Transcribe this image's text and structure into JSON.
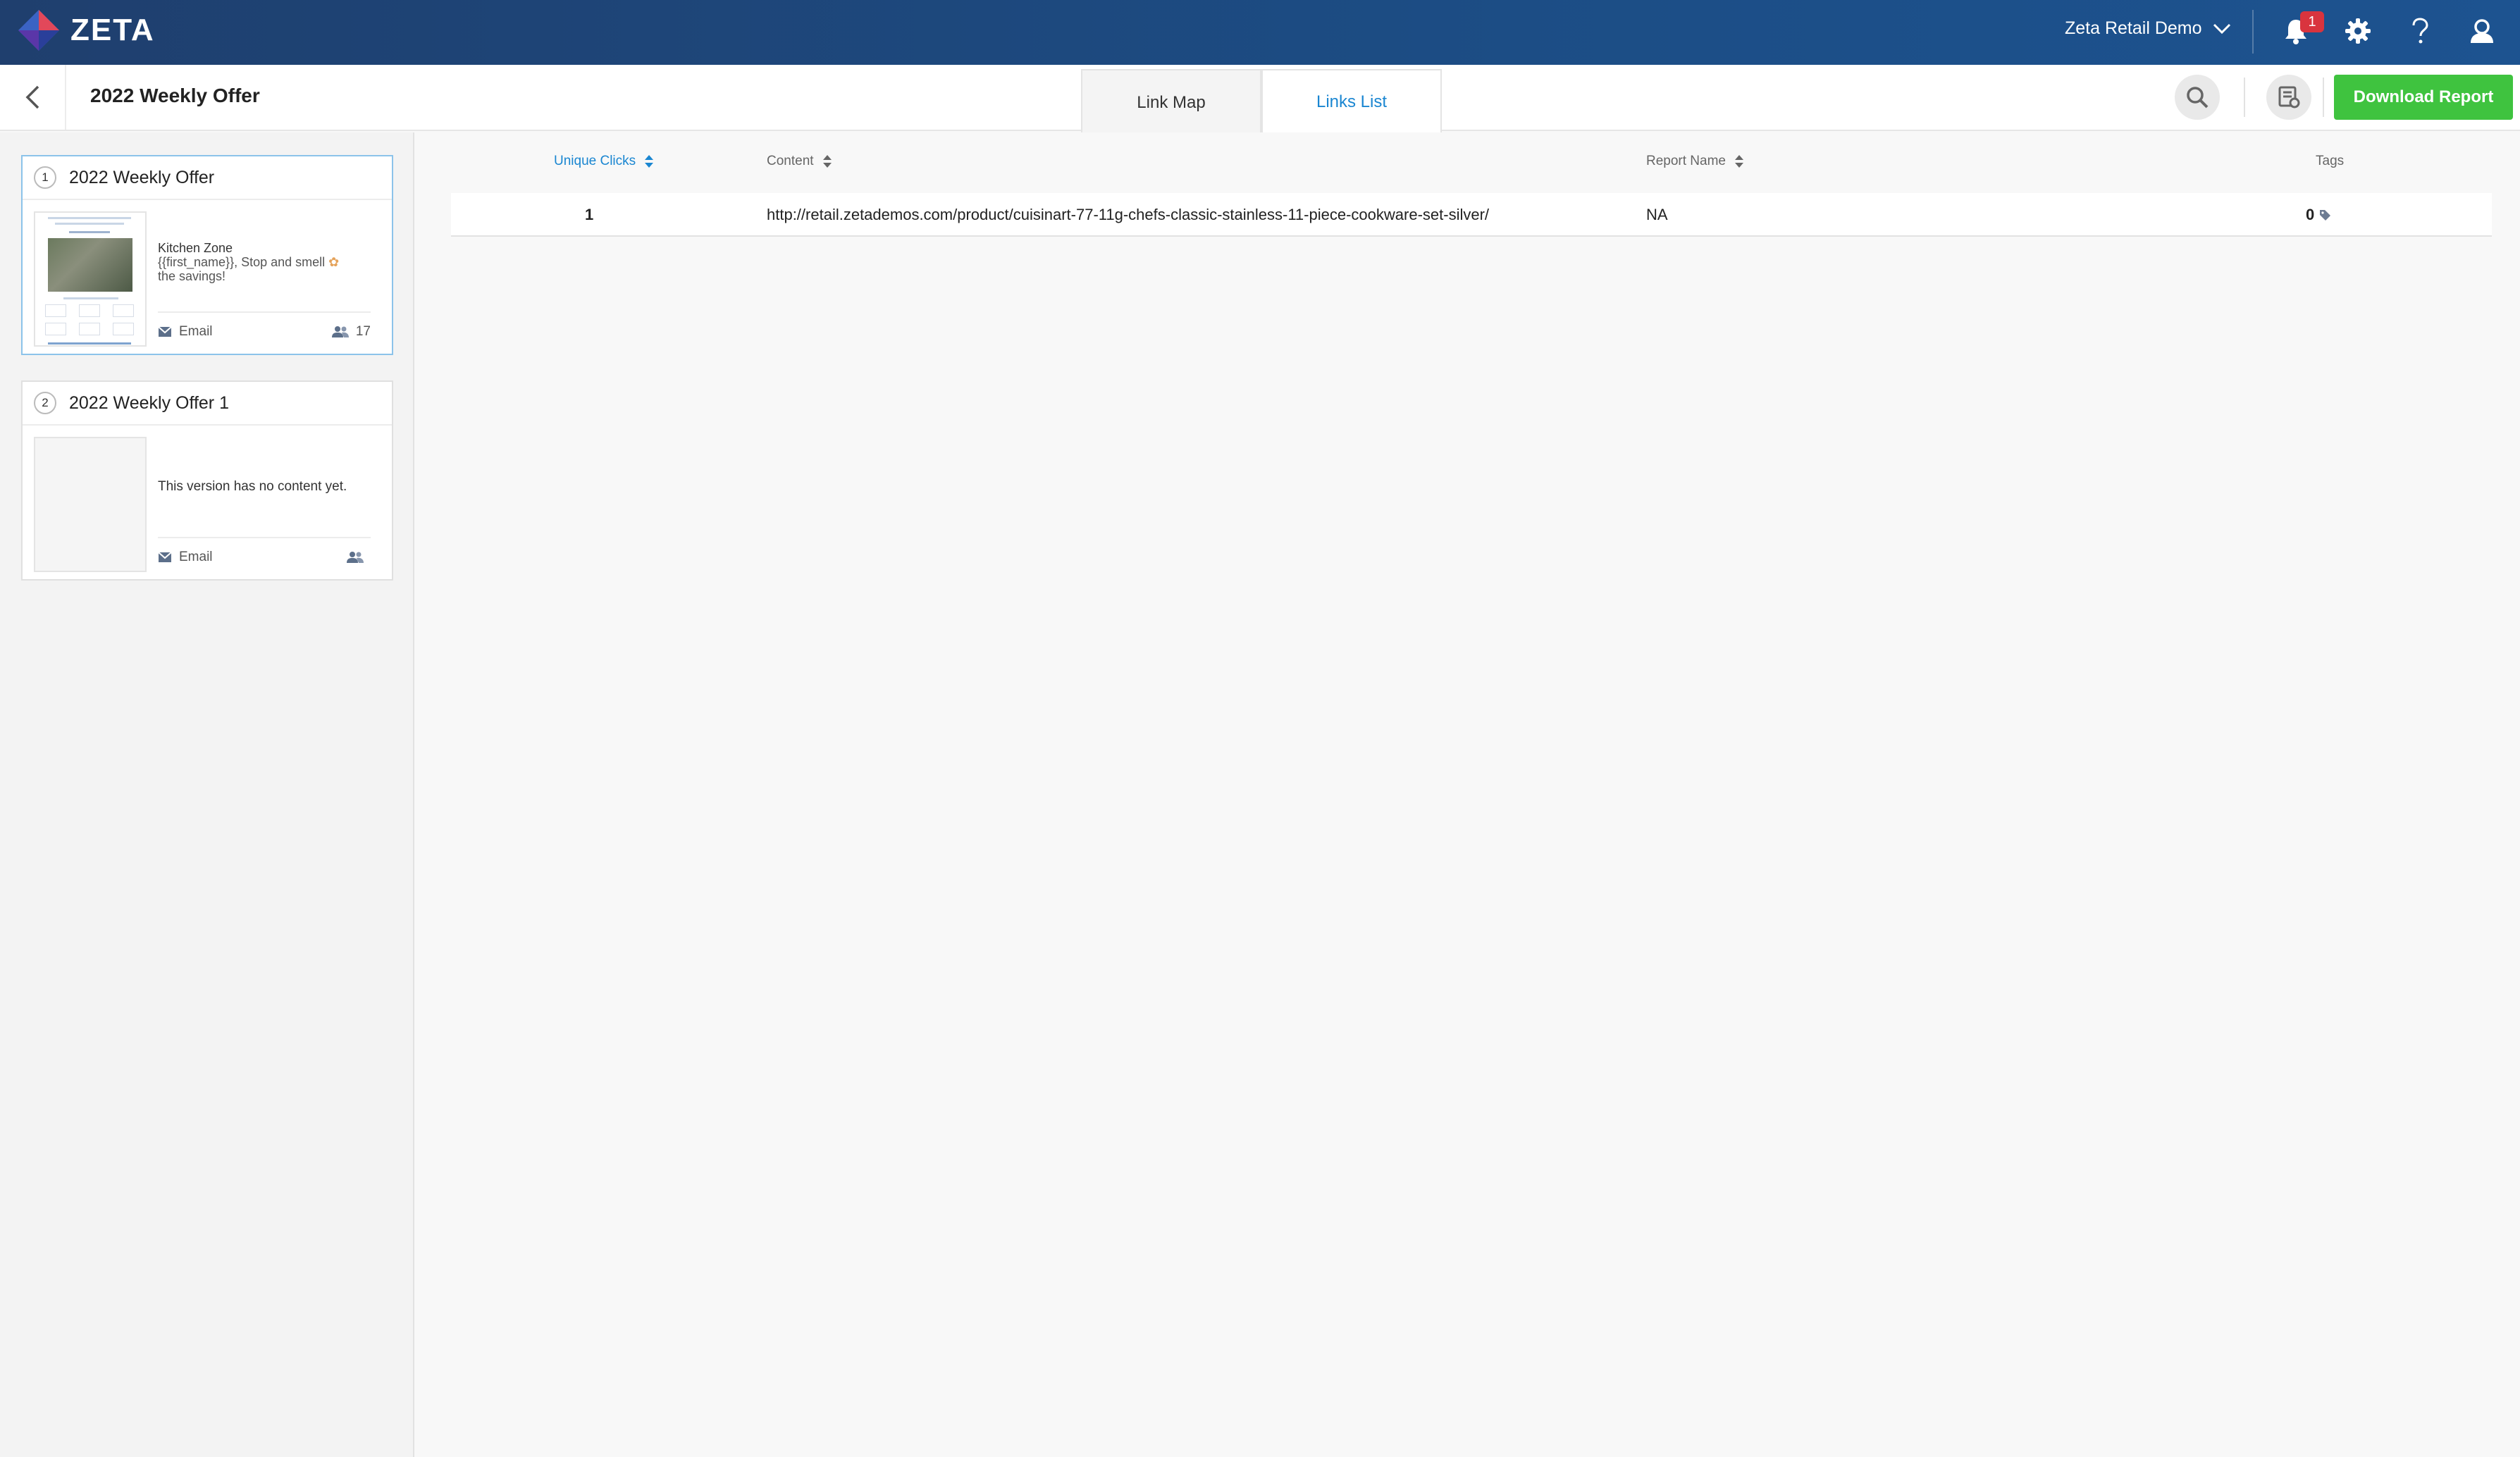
{
  "brand": {
    "name": "ZETA"
  },
  "topnav": {
    "account": "Zeta Retail Demo",
    "notifications_count": "1",
    "icons": [
      "bell-icon",
      "gear-icon",
      "help-icon",
      "user-icon"
    ]
  },
  "header": {
    "title": "2022 Weekly Offer",
    "tabs": [
      {
        "label": "Link Map",
        "active": false
      },
      {
        "label": "Links List",
        "active": true
      }
    ],
    "download_label": "Download Report"
  },
  "versions": [
    {
      "index": "1",
      "title": "2022 Weekly Offer",
      "selected": true,
      "snippet_title": "Kitchen Zone",
      "snippet_sub": "{{first_name}}, Stop and smell",
      "snippet_sub2": "the savings!",
      "channel": "Email",
      "audience": "17"
    },
    {
      "index": "2",
      "title": "2022 Weekly Offer 1",
      "selected": false,
      "no_content": "This version has no content yet.",
      "channel": "Email",
      "audience": ""
    }
  ],
  "table": {
    "columns": [
      {
        "label": "Unique Clicks",
        "sortable": true,
        "active": true
      },
      {
        "label": "Content",
        "sortable": true,
        "active": false
      },
      {
        "label": "Report Name",
        "sortable": true,
        "active": false
      },
      {
        "label": "Tags",
        "sortable": false,
        "active": false
      }
    ],
    "rows": [
      {
        "unique_clicks": "1",
        "content": "http://retail.zetademos.com/product/cuisinart-77-11g-chefs-classic-stainless-11-piece-cookware-set-silver/",
        "report_name": "NA",
        "tags": "0"
      }
    ]
  },
  "colors": {
    "accent": "#1a86d1",
    "download": "#3fc33f",
    "navbar": "#1c4d85",
    "badge": "#d9343e"
  }
}
